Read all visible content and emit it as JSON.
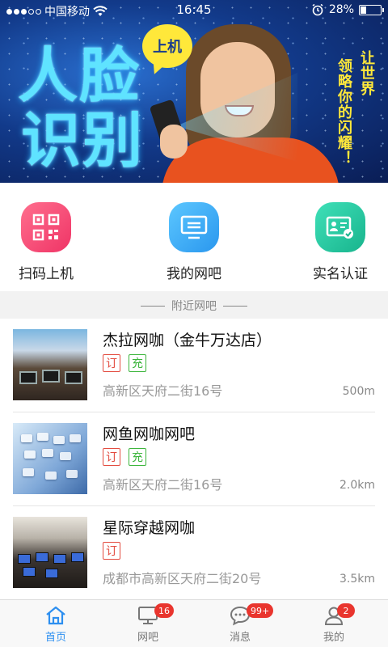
{
  "status_bar": {
    "carrier": "中国移动",
    "time": "16:45",
    "battery": "28%",
    "battery_level": 0.28
  },
  "banner": {
    "headline_line1": "人脸",
    "headline_line2": "识别",
    "bubble": "上机",
    "slogan_col1": "让世界",
    "slogan_col2": "领略你的闪耀！"
  },
  "actions": [
    {
      "label": "扫码上机",
      "icon": "qrcode-icon",
      "color": "#ef3466"
    },
    {
      "label": "我的网吧",
      "icon": "monitor-icon",
      "color": "#2a97ee"
    },
    {
      "label": "实名认证",
      "icon": "id-card-icon",
      "color": "#18b48d"
    }
  ],
  "section": {
    "title": "附近网吧"
  },
  "cafes": [
    {
      "name": "杰拉网咖（金牛万达店）",
      "tags": [
        "订",
        "充"
      ],
      "address": "高新区天府二街16号",
      "distance": "500m"
    },
    {
      "name": "网鱼网咖网吧",
      "tags": [
        "订",
        "充"
      ],
      "address": "高新区天府二街16号",
      "distance": "2.0km"
    },
    {
      "name": "星际穿越网咖",
      "tags": [
        "订"
      ],
      "address": "成都市高新区天府二街20号",
      "distance": "3.5km"
    }
  ],
  "tabbar": {
    "home": {
      "label": "首页",
      "icon": "home-icon"
    },
    "netcafe": {
      "label": "网吧",
      "badge": "16",
      "icon": "monitor-icon"
    },
    "messages": {
      "label": "消息",
      "badge": "99+",
      "icon": "chat-icon"
    },
    "me": {
      "label": "我的",
      "badge": "2",
      "icon": "user-icon"
    }
  },
  "colors": {
    "accent": "#2d8ff0",
    "badge": "#e9352e",
    "tag_red": "#e34b3f",
    "tag_green": "#3cb53c"
  }
}
